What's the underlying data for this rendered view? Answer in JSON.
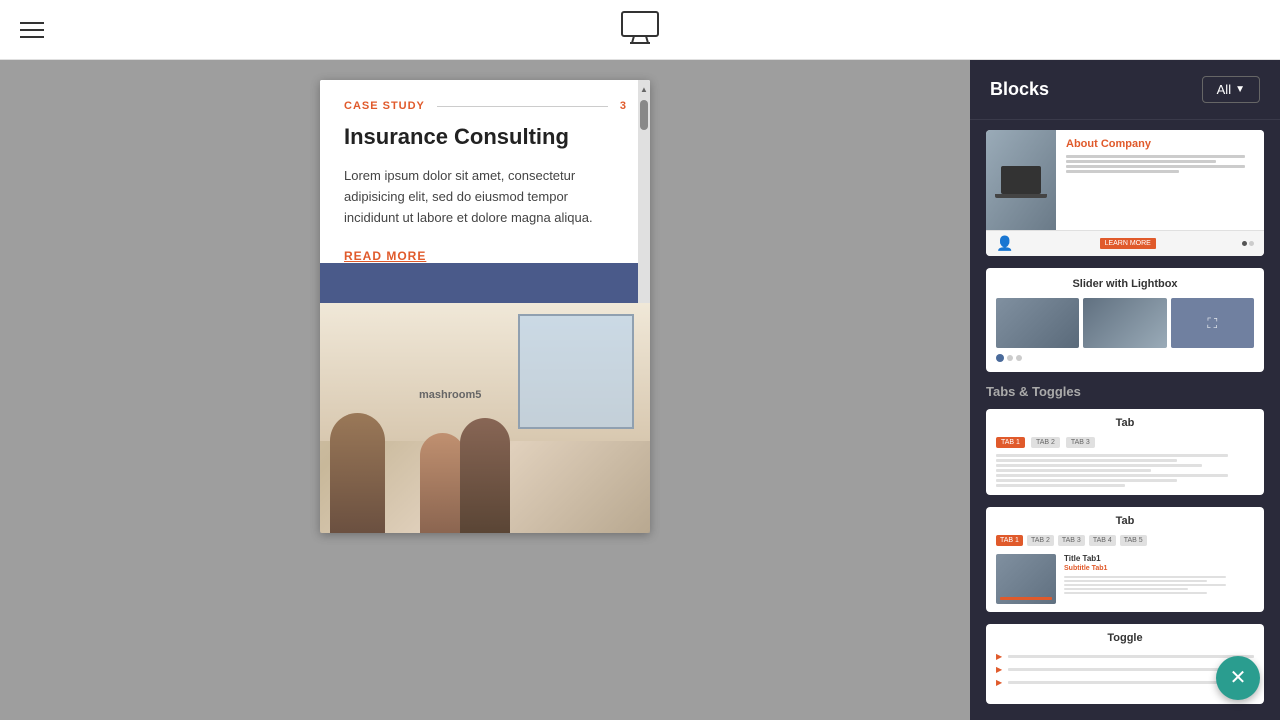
{
  "header": {
    "monitor_icon_label": "monitor-icon"
  },
  "sidebar": {
    "title": "Blocks",
    "all_button": "All",
    "all_button_chevron": "▼",
    "blocks": {
      "about_company": {
        "title": "About Company",
        "cta": "LEARN MORE"
      },
      "slider_lightbox": {
        "title": "Slider with Lightbox"
      },
      "tabs_toggles_section": "Tabs & Toggles",
      "tab1": {
        "title": "Tab",
        "tab1_label": "TAB 1",
        "tab2_label": "TAB 2",
        "tab3_label": "TAB 3"
      },
      "tab2": {
        "title": "Tab",
        "tab_labels": [
          "TAB 1",
          "TAB 2",
          "TAB 3",
          "TAB 4",
          "TAB 5"
        ],
        "content_title": "Title Tab1",
        "content_subtitle": "Subtitle Tab1"
      },
      "toggle": {
        "title": "Toggle"
      }
    }
  },
  "canvas": {
    "case_study_label": "CASE STUDY",
    "case_study_number": "3",
    "title": "Insurance Consulting",
    "body": "Lorem ipsum dolor sit amet, consectetur adipisicing elit, sed do eiusmod tempor incididunt ut labore et dolore magna aliqua.",
    "read_more": "READ MORE",
    "mashroom_text": "mashroom5"
  }
}
